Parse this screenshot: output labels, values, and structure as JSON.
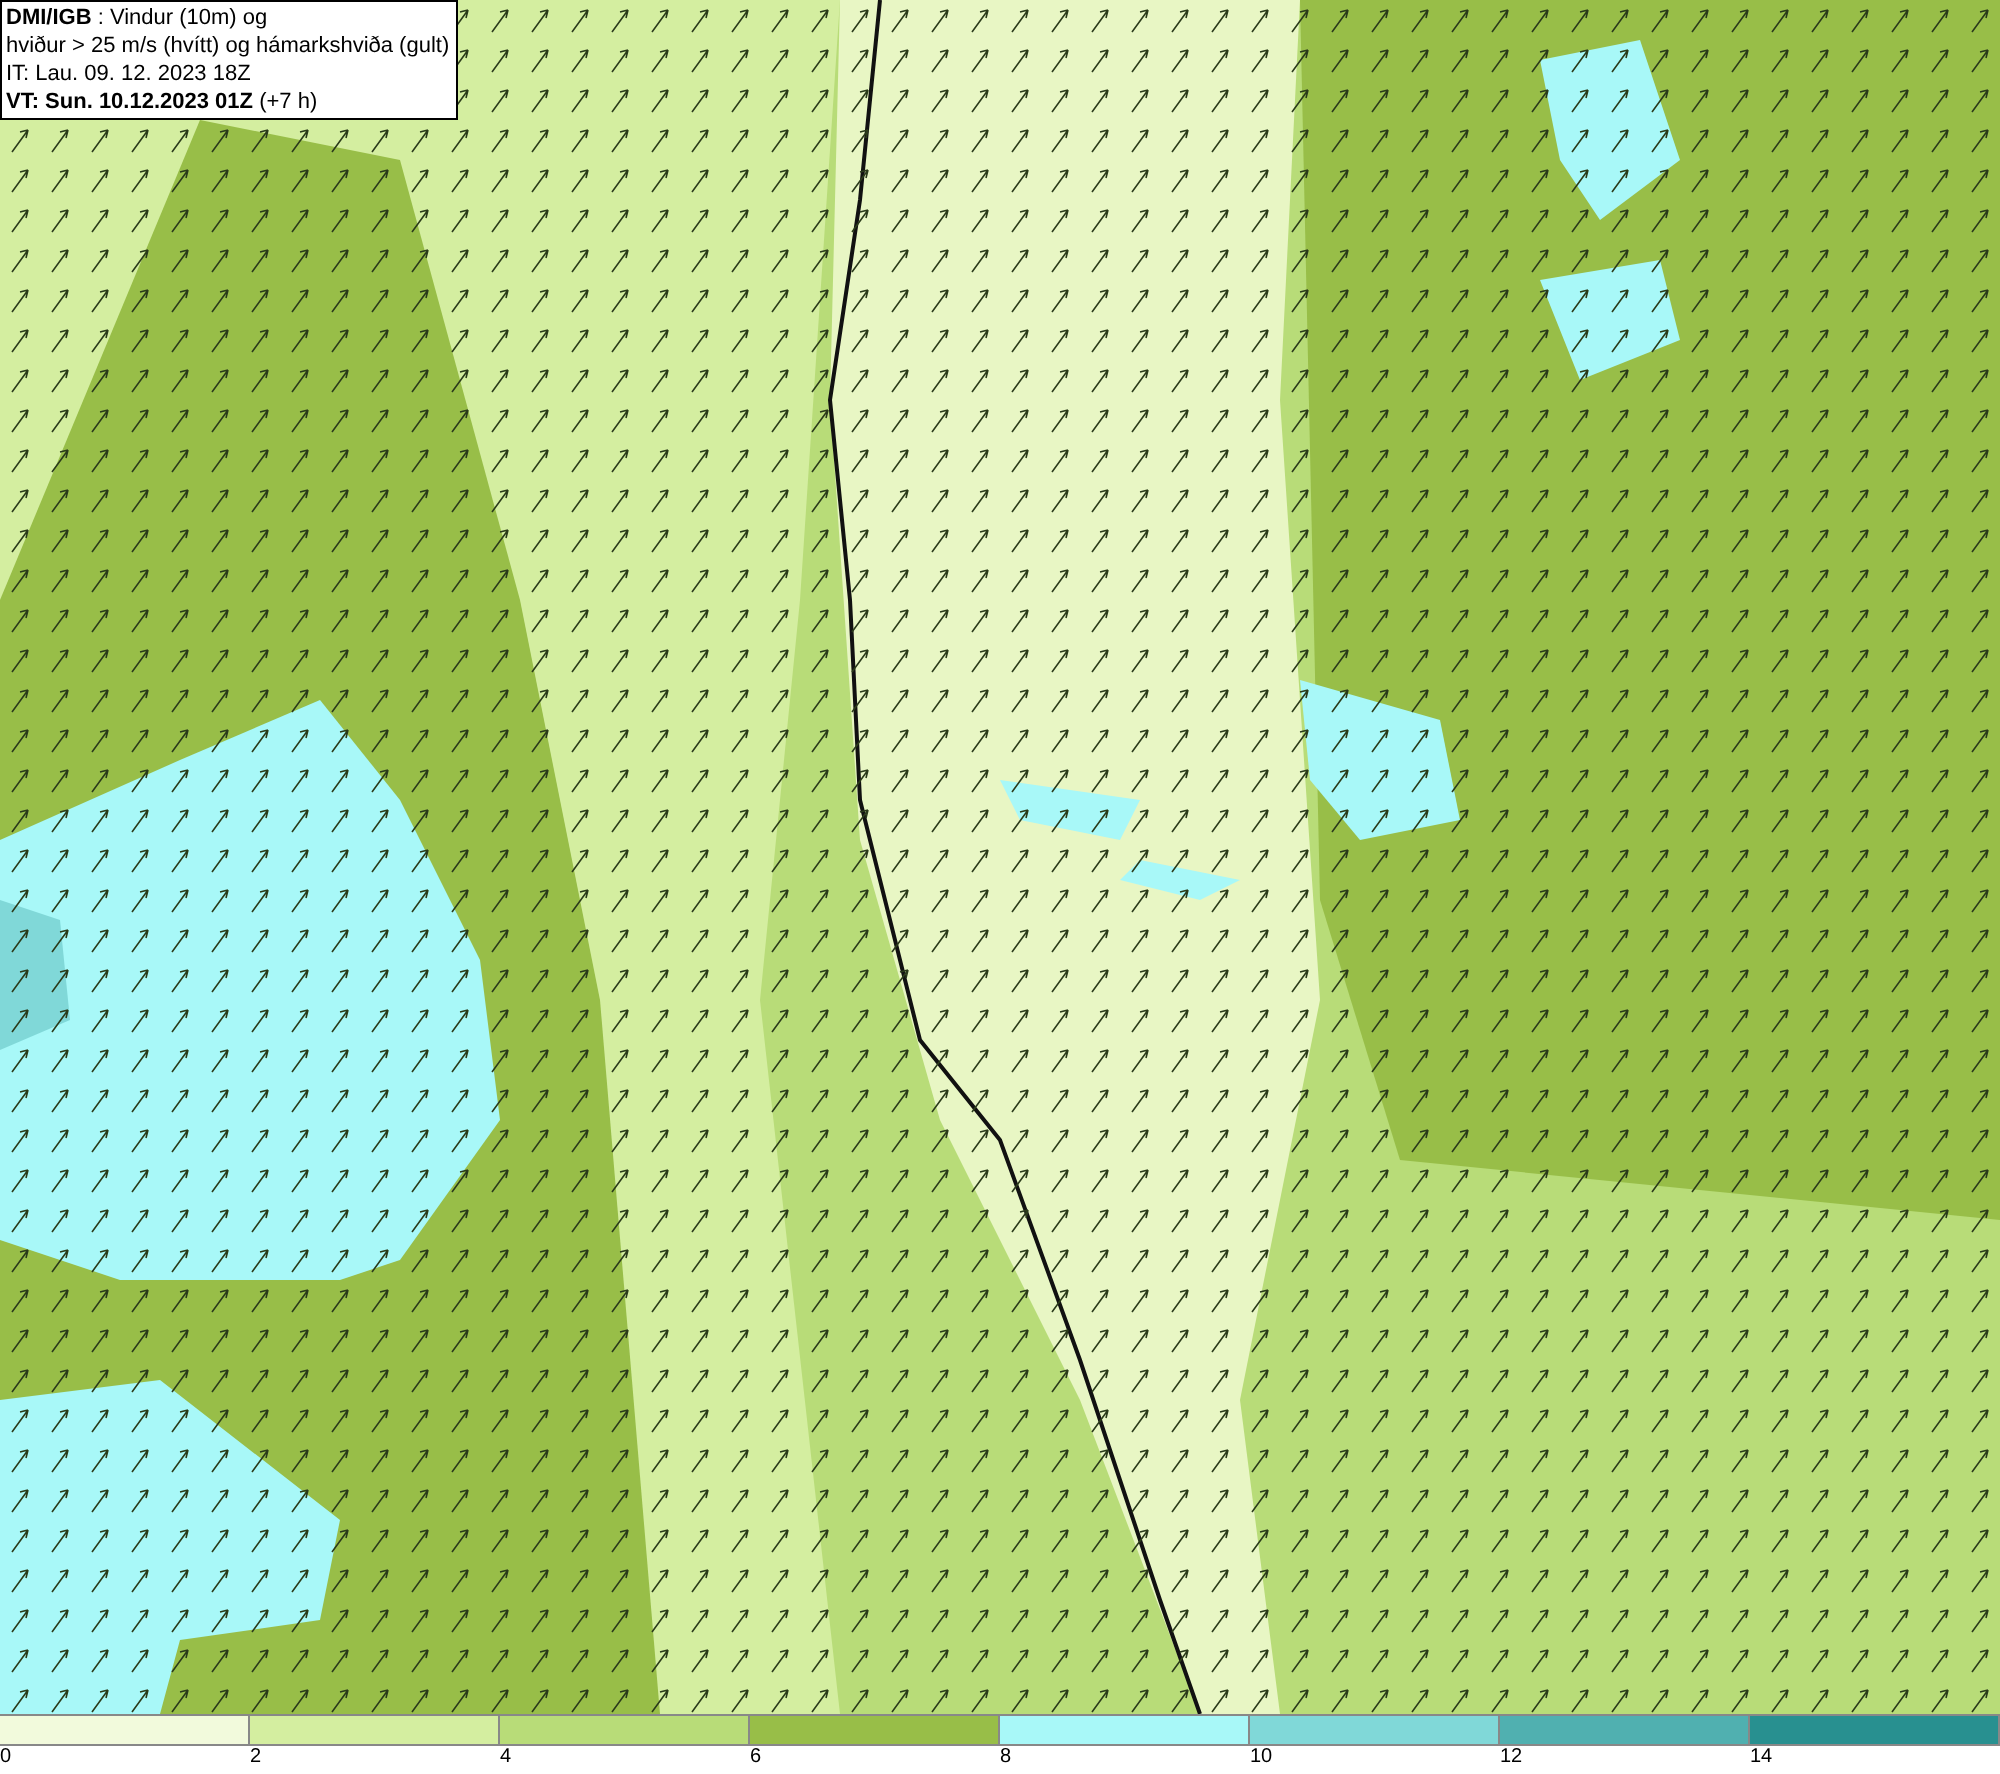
{
  "title_box": {
    "lines": [
      "**DMI/IGB** : Vindur (10m) og",
      "hviður > 25 m/s (hvítt) og hámarkshviða (gult)",
      "IT: Lau. 09. 12. 2023 18Z",
      "**VT: Sun. 10.12.2023 01Z** (+7 h)"
    ]
  },
  "legend": {
    "segments": [
      {
        "color": "#f2fadc"
      },
      {
        "color": "#d4eea0"
      },
      {
        "color": "#b8dc78"
      },
      {
        "color": "#98be48"
      },
      {
        "color": "#a8f8f8"
      },
      {
        "color": "#80d8d8"
      },
      {
        "color": "#50b0b0"
      },
      {
        "color": "#289090"
      }
    ],
    "ticks": [
      "0",
      "2",
      "4",
      "6",
      "8",
      "10",
      "12",
      "14"
    ]
  }
}
